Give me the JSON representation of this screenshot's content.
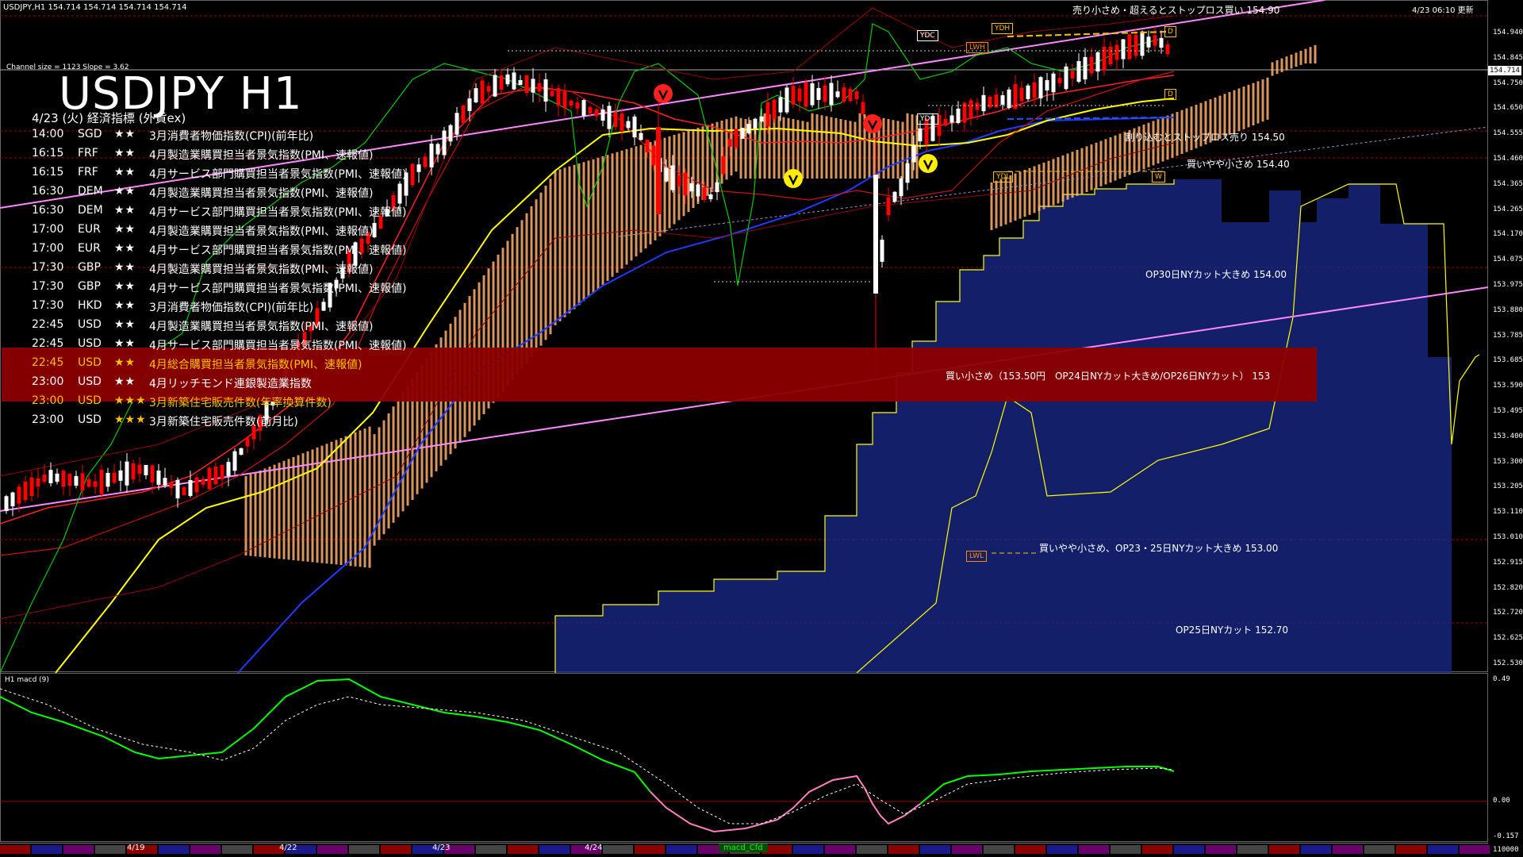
{
  "header": {
    "symbol_info": "USDJPY,H1",
    "ohlc": "154.714 154.714 154.714 154.714",
    "update_time": "4/23 06:10 更新",
    "channel_info": "Channel size = 1123 Slope = 3.62"
  },
  "chart": {
    "title": "USDJPY H1",
    "subtitle": "4/23 (火) 経済指標 (外貨ex)",
    "current_price": "154.714"
  },
  "events": [
    {
      "time": "14:00",
      "ccy": "SGD",
      "stars": "★★",
      "name": "3月消費者物価指数(CPI)(前年比)",
      "highlight": false
    },
    {
      "time": "16:15",
      "ccy": "FRF",
      "stars": "★★",
      "name": "4月製造業購買担当者景気指数(PMI、速報値)",
      "highlight": false
    },
    {
      "time": "16:15",
      "ccy": "FRF",
      "stars": "★★",
      "name": "4月サービス部門購買担当者景気指数(PMI、速報値)",
      "highlight": false
    },
    {
      "time": "16:30",
      "ccy": "DEM",
      "stars": "★★",
      "name": "4月製造業購買担当者景気指数(PMI、速報値)",
      "highlight": false
    },
    {
      "time": "16:30",
      "ccy": "DEM",
      "stars": "★★",
      "name": "4月サービス部門購買担当者景気指数(PMI、速報値)",
      "highlight": false
    },
    {
      "time": "17:00",
      "ccy": "EUR",
      "stars": "★★",
      "name": "4月製造業購買担当者景気指数(PMI、速報値)",
      "highlight": false
    },
    {
      "time": "17:00",
      "ccy": "EUR",
      "stars": "★★",
      "name": "4月サービス部門購買担当者景気指数(PMI、速報値)",
      "highlight": false
    },
    {
      "time": "17:30",
      "ccy": "GBP",
      "stars": "★★",
      "name": "4月製造業購買担当者景気指数(PMI、速報値)",
      "highlight": false
    },
    {
      "time": "17:30",
      "ccy": "GBP",
      "stars": "★★",
      "name": "4月サービス部門購買担当者景気指数(PMI、速報値)",
      "highlight": false
    },
    {
      "time": "17:30",
      "ccy": "HKD",
      "stars": "★★",
      "name": "3月消費者物価指数(CPI)(前年比)",
      "highlight": false
    },
    {
      "time": "22:45",
      "ccy": "USD",
      "stars": "★★",
      "name": "4月製造業購買担当者景気指数(PMI、速報値)",
      "highlight": false
    },
    {
      "time": "22:45",
      "ccy": "USD",
      "stars": "★★",
      "name": "4月サービス部門購買担当者景気指数(PMI、速報値)",
      "highlight": false
    },
    {
      "time": "22:45",
      "ccy": "USD",
      "stars": "★★",
      "name": "4月総合購買担当者景気指数(PMI、速報値)",
      "highlight": true
    },
    {
      "time": "23:00",
      "ccy": "USD",
      "stars": "★★",
      "name": "4月リッチモンド連銀製造業指数",
      "highlight": false
    },
    {
      "time": "23:00",
      "ccy": "USD",
      "stars": "★★★",
      "name": "3月新築住宅販売件数(年率換算件数)",
      "highlight": true
    },
    {
      "time": "23:00",
      "ccy": "USD",
      "stars": "★★★",
      "name": "3月新築住宅販売件数(前月比)",
      "highlight": false
    }
  ],
  "annotations": [
    {
      "text": "売り小さめ・超えるとストップロス買い 154.90"
    },
    {
      "text": "割り込むとストップロス売り 154.50"
    },
    {
      "text": "買いやや小さめ 154.40"
    },
    {
      "text": "OP30日NYカット大きめ 154.00"
    },
    {
      "text": "買い小さめ（153.50円　OP24日NYカット大きめ/OP26日NYカット） 153"
    },
    {
      "text": "買いやや小さめ、OP23・25日NYカット大きめ 153.00"
    },
    {
      "text": "OP25日NYカット 152.70"
    }
  ],
  "level_labels": [
    "YDC",
    "YDH",
    "LWH",
    "YDC",
    "YDL",
    "LWL",
    "D",
    "D",
    "W"
  ],
  "price_axis": [
    "154.940",
    "154.845",
    "154.750",
    "154.650",
    "154.555",
    "154.460",
    "154.365",
    "154.265",
    "154.170",
    "154.075",
    "153.975",
    "153.880",
    "153.785",
    "153.685",
    "153.590",
    "153.495",
    "153.400",
    "153.300",
    "153.205",
    "153.110",
    "153.010",
    "152.915",
    "152.820",
    "152.720",
    "152.625",
    "152.530"
  ],
  "macd": {
    "label": "H1 macd (9)",
    "axis_top": "0.49",
    "axis_zero": "0.00",
    "axis_bottom": "-0.157",
    "corner": "110000",
    "bottom_tag": "macd_Cfd"
  },
  "dates": [
    "4/19",
    "4/22",
    "4/23",
    "4/24"
  ],
  "colors": {
    "background": "#000000",
    "bull_candle": "#ffffff",
    "bear_candle": "#ff0000",
    "cloud_bull": "#ffb070",
    "cloud_bear": "#1a2a8c",
    "ma_yellow": "#ffff00",
    "ma_blue": "#1e3cff",
    "ma_red": "#ff2020",
    "trend_line": "#ff88ff",
    "macd_line": "#00ff00",
    "macd_signal": "#ffffff",
    "highlight_band": "#8b0000",
    "accent_gold": "#ffc000"
  }
}
